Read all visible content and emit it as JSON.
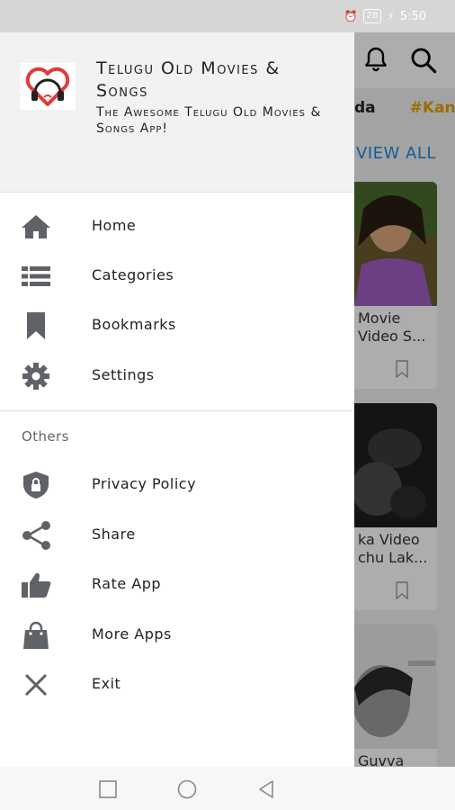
{
  "status_bar": {
    "battery": "28",
    "time": "5:50"
  },
  "background": {
    "tags": [
      "da",
      "#Kan"
    ],
    "view_all": "VIEW ALL",
    "cards": [
      {
        "title_line1": "Movie",
        "title_line2": "Video S..."
      },
      {
        "title_line1": "ka Video",
        "title_line2": "chu Lak..."
      },
      {
        "title_line1": "Guvva",
        "title_line2": ""
      }
    ]
  },
  "drawer": {
    "app_title": "Telugu Old Movies & Songs",
    "app_subtitle": "The Awesome Telugu Old Movies & Songs App!",
    "menu": [
      {
        "label": "Home",
        "icon": "home-icon"
      },
      {
        "label": "Categories",
        "icon": "list-icon"
      },
      {
        "label": "Bookmarks",
        "icon": "bookmark-icon"
      },
      {
        "label": "Settings",
        "icon": "gear-icon"
      }
    ],
    "others_label": "Others",
    "others": [
      {
        "label": "Privacy Policy",
        "icon": "shield-lock-icon"
      },
      {
        "label": "Share",
        "icon": "share-icon"
      },
      {
        "label": "Rate App",
        "icon": "thumbs-up-icon"
      },
      {
        "label": "More Apps",
        "icon": "shopping-bag-icon"
      },
      {
        "label": "Exit",
        "icon": "close-icon"
      }
    ]
  },
  "nav_bar": {
    "buttons": [
      "recent-apps",
      "home",
      "back"
    ]
  },
  "colors": {
    "accent_blue": "#1e88e5",
    "tag_orange": "#e6a100",
    "icon_gray": "#5f6368",
    "logo_red": "#e53935"
  }
}
